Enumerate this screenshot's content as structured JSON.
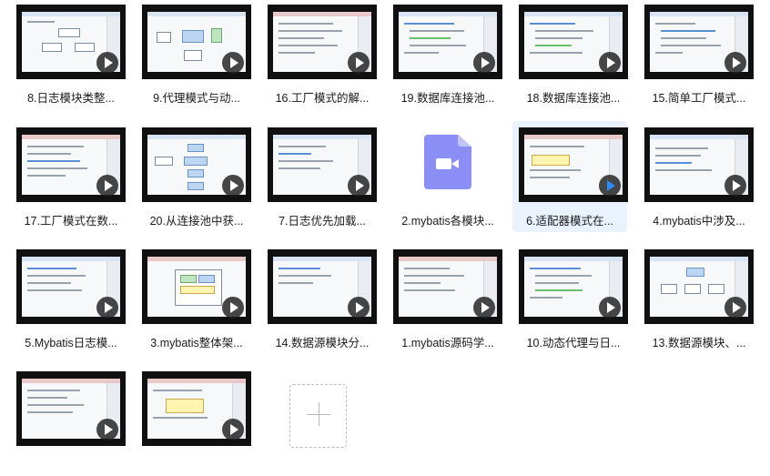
{
  "grid": {
    "rows": [
      {
        "files": [
          {
            "name": "8.日志模块类整...",
            "kind": "video"
          },
          {
            "name": "9.代理模式与动...",
            "kind": "video"
          },
          {
            "name": "16.工厂模式的解...",
            "kind": "video"
          },
          {
            "name": "19.数据库连接池...",
            "kind": "video"
          },
          {
            "name": "18.数据库连接池...",
            "kind": "video"
          },
          {
            "name": "15.简单工厂模式...",
            "kind": "video"
          }
        ]
      },
      {
        "files": [
          {
            "name": "17.工厂模式在数...",
            "kind": "video"
          },
          {
            "name": "20.从连接池中获...",
            "kind": "video"
          },
          {
            "name": "7.日志优先加载...",
            "kind": "video"
          },
          {
            "name": "2.mybatis各模块...",
            "kind": "video-file-icon"
          },
          {
            "name": "6.适配器模式在...",
            "kind": "video",
            "selected": true
          },
          {
            "name": "4.mybatis中涉及...",
            "kind": "video"
          }
        ]
      },
      {
        "files": [
          {
            "name": "5.Mybatis日志模...",
            "kind": "video"
          },
          {
            "name": "3.mybatis整体架...",
            "kind": "video"
          },
          {
            "name": "14.数据源模块分...",
            "kind": "video"
          },
          {
            "name": "1.mybatis源码学...",
            "kind": "video"
          },
          {
            "name": "10.动态代理与日...",
            "kind": "video"
          },
          {
            "name": "13.数据源模块、...",
            "kind": "video"
          }
        ]
      },
      {
        "files": [
          {
            "name": "",
            "kind": "video"
          },
          {
            "name": "",
            "kind": "video"
          }
        ]
      }
    ]
  },
  "add_button": {
    "icon": "plus-icon"
  },
  "colors": {
    "selected_bg": "#eaf3fd",
    "file_icon": "#8a8ef5",
    "play_accent": "#2f8af5"
  }
}
